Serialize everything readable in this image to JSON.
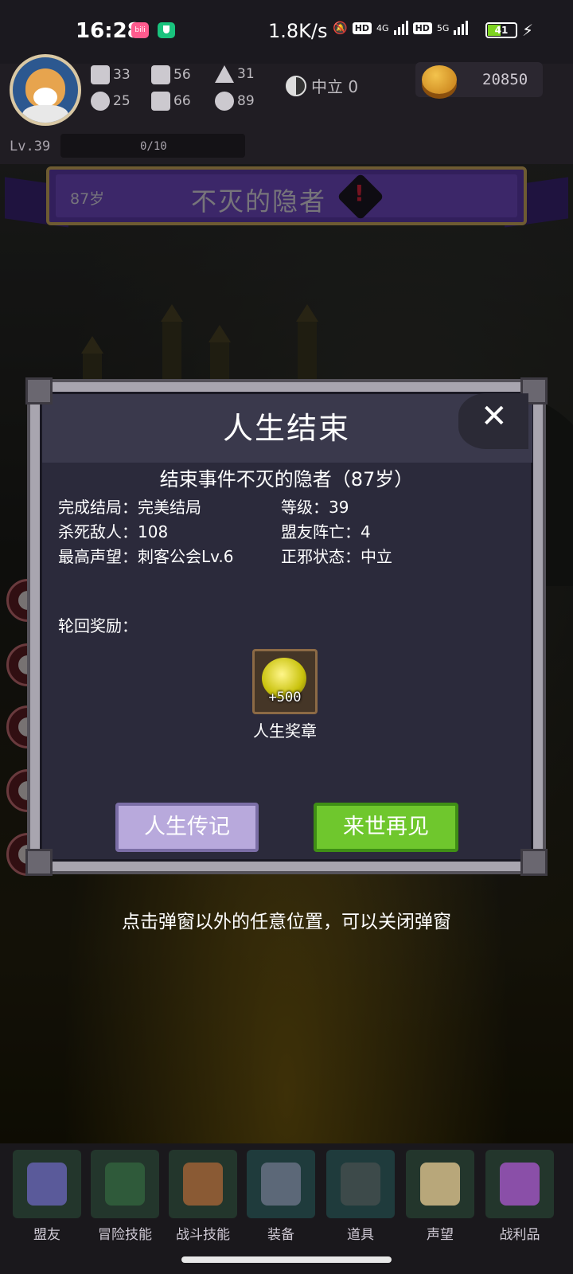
{
  "status_bar": {
    "time": "16:28",
    "app_badge": "bili",
    "net_speed": "1.8K/s",
    "hd1": "HD",
    "sig1": "4G",
    "hd2": "HD",
    "sig2": "5G",
    "battery": "41"
  },
  "player": {
    "stats": [
      {
        "icon": "fist-icon",
        "value": "33"
      },
      {
        "icon": "hand-icon",
        "value": "56"
      },
      {
        "icon": "wizard-hat-icon",
        "value": "31"
      },
      {
        "icon": "clover-icon",
        "value": "25"
      },
      {
        "icon": "book-icon",
        "value": "66"
      },
      {
        "icon": "wings-icon",
        "value": "89"
      }
    ],
    "alignment": "中立 0",
    "gold": "20850",
    "level": "Lv.39",
    "xp": "0/10"
  },
  "banner": {
    "age": "87岁",
    "title": "不灭的隐者"
  },
  "dialog": {
    "title": "人生结束",
    "close": "✕",
    "summary": "结束事件不灭的隐者（87岁）",
    "stats_left": [
      "完成结局：完美结局",
      "杀死敌人：108",
      "最高声望：刺客公会Lv.6"
    ],
    "stats_right": [
      "等级：39",
      "盟友阵亡：4",
      "正邪状态：中立"
    ],
    "rewards_label": "轮回奖励：",
    "reward": {
      "amount": "+500",
      "name": "人生奖章"
    },
    "buttons": {
      "biography": "人生传记",
      "next_life": "来世再见"
    }
  },
  "hint": "点击弹窗以外的任意位置，可以关闭弹窗",
  "nav": [
    {
      "label": "盟友",
      "icon": "handshake-icon"
    },
    {
      "label": "冒险技能",
      "icon": "skill-book-icon"
    },
    {
      "label": "战斗技能",
      "icon": "backpack-icon"
    },
    {
      "label": "装备",
      "icon": "crossed-swords-icon"
    },
    {
      "label": "道具",
      "icon": "pouch-icon"
    },
    {
      "label": "声望",
      "icon": "scroll-icon"
    },
    {
      "label": "战利品",
      "icon": "treasure-chest-icon"
    }
  ]
}
